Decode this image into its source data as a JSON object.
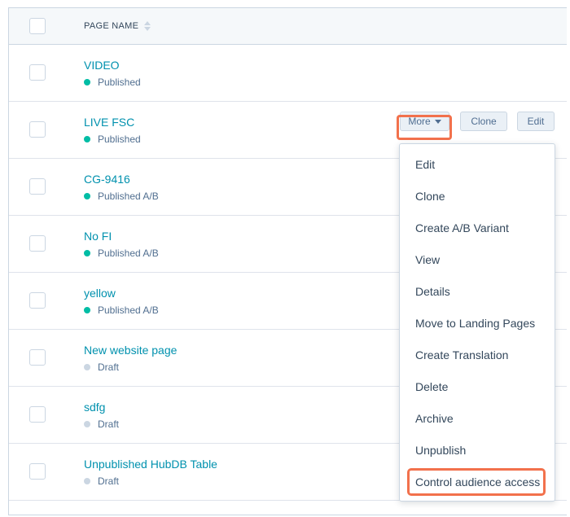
{
  "header": {
    "column_label": "PAGE NAME"
  },
  "rows": [
    {
      "name": "VIDEO",
      "status": "Published",
      "status_color": "#00bda5"
    },
    {
      "name": "LIVE FSC",
      "status": "Published",
      "status_color": "#00bda5"
    },
    {
      "name": "CG-9416",
      "status": "Published A/B",
      "status_color": "#00bda5"
    },
    {
      "name": "No FI",
      "status": "Published A/B",
      "status_color": "#00bda5"
    },
    {
      "name": "yellow",
      "status": "Published A/B",
      "status_color": "#00bda5"
    },
    {
      "name": "New website page",
      "status": "Draft",
      "status_color": "#cbd6e2"
    },
    {
      "name": "sdfg",
      "status": "Draft",
      "status_color": "#cbd6e2"
    },
    {
      "name": "Unpublished HubDB Table",
      "status": "Draft",
      "status_color": "#cbd6e2"
    }
  ],
  "row_actions": {
    "more_label": "More",
    "clone_label": "Clone",
    "edit_label": "Edit"
  },
  "menu": {
    "items": [
      "Edit",
      "Clone",
      "Create A/B Variant",
      "View",
      "Details",
      "Move to Landing Pages",
      "Create Translation",
      "Delete",
      "Archive",
      "Unpublish",
      "Control audience access"
    ],
    "highlighted_item": "Control audience access",
    "highlight_color": "#f2714c"
  },
  "colors": {
    "link": "#0091ae",
    "published": "#00bda5",
    "draft": "#cbd6e2",
    "border": "#cbd6e2"
  }
}
